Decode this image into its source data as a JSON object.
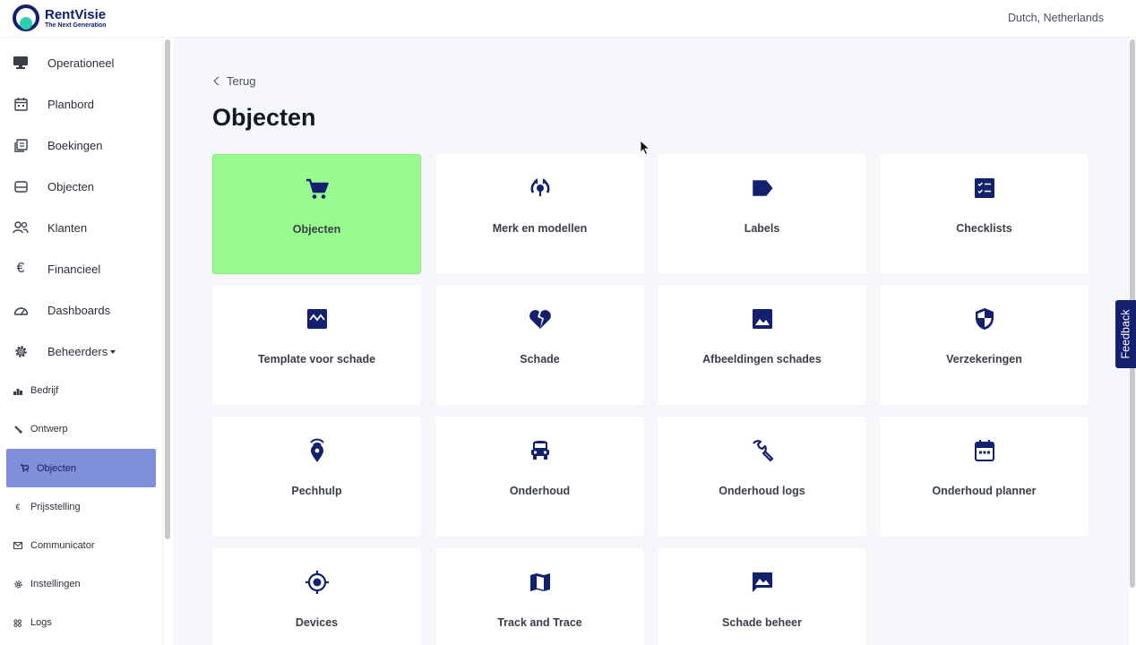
{
  "header": {
    "brand_name": "RentVisie",
    "brand_tagline": "The Next Generation",
    "language": "Dutch, Netherlands"
  },
  "sidebar": {
    "items": [
      {
        "label": "Operationeel",
        "icon": "monitor-icon"
      },
      {
        "label": "Planbord",
        "icon": "calendar-icon"
      },
      {
        "label": "Boekingen",
        "icon": "bookings-icon"
      },
      {
        "label": "Objecten",
        "icon": "inbox-icon"
      },
      {
        "label": "Klanten",
        "icon": "users-icon"
      },
      {
        "label": "Financieel",
        "icon": "euro-icon"
      },
      {
        "label": "Dashboards",
        "icon": "gauge-icon"
      },
      {
        "label": "Beheerders",
        "icon": "gear-icon"
      }
    ],
    "subitems": [
      {
        "label": "Bedrijf",
        "icon": "chart-icon"
      },
      {
        "label": "Ontwerp",
        "icon": "brush-icon"
      },
      {
        "label": "Objecten",
        "icon": "cart-icon",
        "active": true
      },
      {
        "label": "Prijsstelling",
        "icon": "euro-icon"
      },
      {
        "label": "Communicator",
        "icon": "mail-icon"
      },
      {
        "label": "Instellingen",
        "icon": "gear-icon"
      },
      {
        "label": "Logs",
        "icon": "logs-icon"
      }
    ]
  },
  "main": {
    "back_label": "Terug",
    "title": "Objecten",
    "tiles": [
      {
        "label": "Objecten",
        "icon": "cart-icon"
      },
      {
        "label": "Merk en modellen",
        "icon": "brand-icon"
      },
      {
        "label": "Labels",
        "icon": "label-icon"
      },
      {
        "label": "Checklists",
        "icon": "checklist-icon"
      },
      {
        "label": "Template voor schade",
        "icon": "damage-template-icon"
      },
      {
        "label": "Schade",
        "icon": "broken-heart-icon"
      },
      {
        "label": "Afbeeldingen schades",
        "icon": "image-icon"
      },
      {
        "label": "Verzekeringen",
        "icon": "shield-icon"
      },
      {
        "label": "Pechhulp",
        "icon": "location-signal-icon"
      },
      {
        "label": "Onderhoud",
        "icon": "car-icon"
      },
      {
        "label": "Onderhoud logs",
        "icon": "wrench-icon"
      },
      {
        "label": "Onderhoud planner",
        "icon": "calendar-icon"
      },
      {
        "label": "Devices",
        "icon": "gps-icon"
      },
      {
        "label": "Track and Trace",
        "icon": "map-icon"
      },
      {
        "label": "Schade beheer",
        "icon": "message-image-icon"
      }
    ]
  },
  "feedback": {
    "label": "Feedback"
  },
  "colors": {
    "brand_navy": "#12206e",
    "active_tile": "#98fb8e",
    "active_sidebar": "#7f8fd9",
    "logo_teal": "#2fd0b0"
  }
}
